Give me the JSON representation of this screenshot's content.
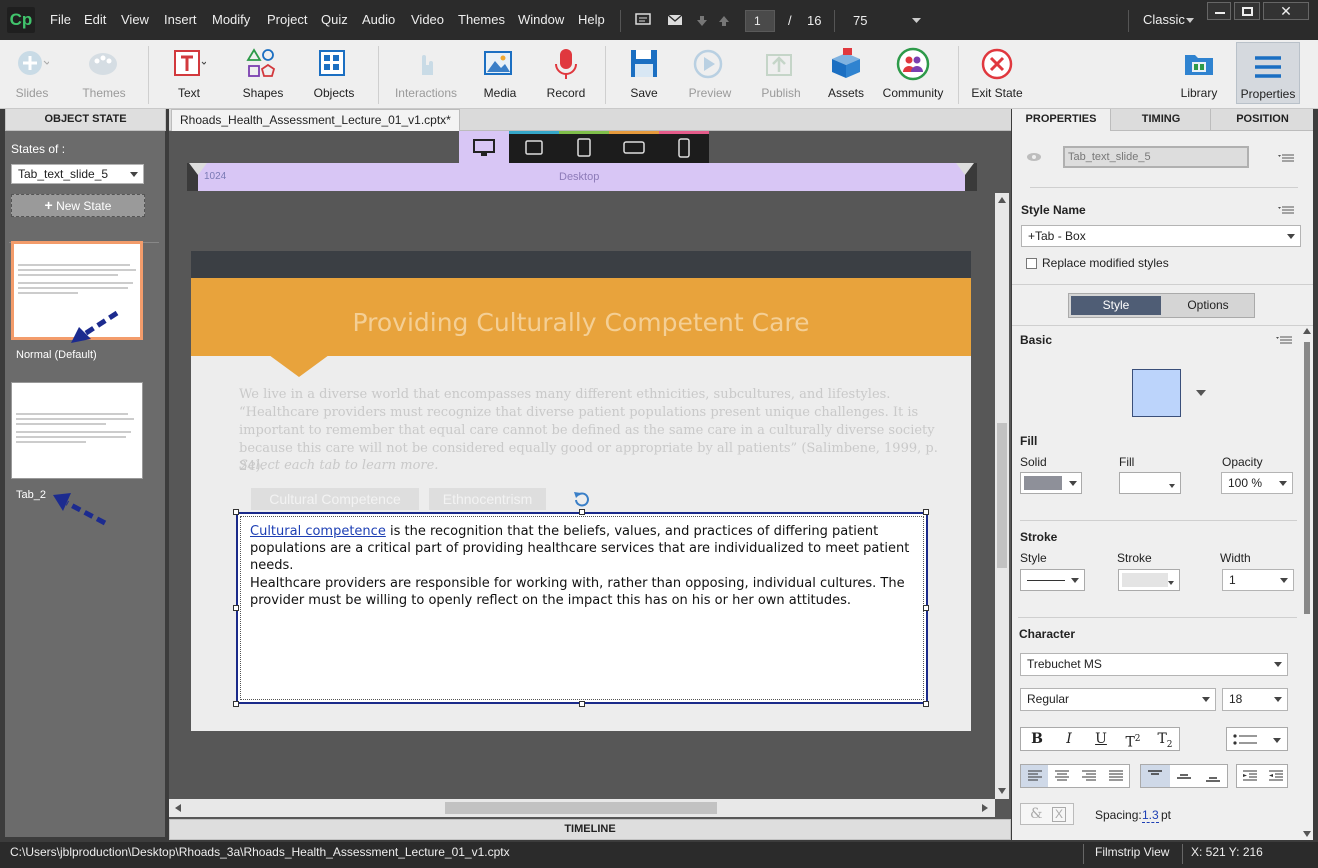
{
  "app": {
    "logo": "Cp"
  },
  "menu": [
    "File",
    "Edit",
    "View",
    "Insert",
    "Modify",
    "Project",
    "Quiz",
    "Audio",
    "Video",
    "Themes",
    "Window",
    "Help"
  ],
  "nav": {
    "current_slide": "1",
    "separator": "/",
    "total_slides": "16",
    "zoom": "75",
    "workspace": "Classic"
  },
  "toolbar": {
    "slides": "Slides",
    "themes": "Themes",
    "text": "Text",
    "shapes": "Shapes",
    "objects": "Objects",
    "interactions": "Interactions",
    "media": "Media",
    "record": "Record",
    "save": "Save",
    "preview": "Preview",
    "publish": "Publish",
    "assets": "Assets",
    "community": "Community",
    "exit_state": "Exit State",
    "library": "Library",
    "properties": "Properties"
  },
  "left": {
    "header": "OBJECT STATE",
    "states_of_label": "States of :",
    "states_of_value": "Tab_text_slide_5",
    "new_state": "New State",
    "states": [
      {
        "label": "Normal (Default)"
      },
      {
        "label": "Tab_2"
      }
    ]
  },
  "doc_tab": "Rhoads_Health_Assessment_Lecture_01_v1.cptx*",
  "ruler": {
    "width": "1024",
    "view": "Desktop"
  },
  "slide": {
    "title": "Providing Culturally Competent Care",
    "intro": "We live in a diverse world that encompasses many different ethnicities, subcultures, and lifestyles. “Healthcare providers must recognize that diverse patient populations present unique challenges. It is important to remember that equal care cannot be defined as the same care in a culturally diverse society because this care will not be considered equally good or appropriate by all patients” (Salimbene, 1999, p. 24).",
    "instruction": "Select each tab to learn more.",
    "tabs": [
      "Cultural Competence",
      "Ethnocentrism"
    ],
    "link_text": "Cultural competence",
    "para1_rest": " is the recognition that the beliefs, values, and practices of differing patient populations are a critical part of providing healthcare services that are individualized to meet patient needs.",
    "para2": "Healthcare providers are responsible for working with, rather than opposing, individual cultures. The provider must be willing to openly reflect on the impact this has on his or her own attitudes."
  },
  "timeline_label": "TIMELINE",
  "right": {
    "tabs": [
      "PROPERTIES",
      "TIMING",
      "POSITION"
    ],
    "object_name": "Tab_text_slide_5",
    "style_name_label": "Style Name",
    "style_name": "+Tab - Box",
    "replace_label": "Replace modified styles",
    "style_tab": "Style",
    "options_tab": "Options",
    "basic": "Basic",
    "fill": "Fill",
    "solid": "Solid",
    "fill_sub": "Fill",
    "opacity": "Opacity",
    "opacity_value": "100 %",
    "stroke": "Stroke",
    "stroke_style": "Style",
    "stroke_stroke": "Stroke",
    "width": "Width",
    "width_value": "1",
    "character": "Character",
    "font": "Trebuchet MS",
    "weight": "Regular",
    "size": "18",
    "spacing_label": "Spacing:",
    "spacing_value": "1.3",
    "spacing_unit": "pt"
  },
  "status": {
    "path": "C:\\Users\\jblproduction\\Desktop\\Rhoads_3a\\Rhoads_Health_Assessment_Lecture_01_v1.cptx",
    "view": "Filmstrip View",
    "coords": "X: 521 Y: 216"
  },
  "colors": {
    "accent_orange": "#e8a33c",
    "band_dark": "#3b3f44",
    "selection_blue": "#1a2a8a",
    "state_highlight": "#f39c6b",
    "tab_purple": "#d8c6f5"
  }
}
